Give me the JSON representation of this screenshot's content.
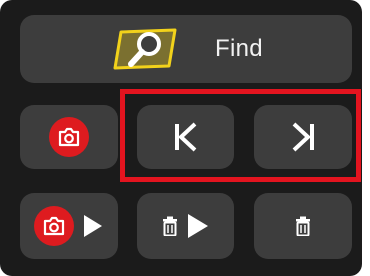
{
  "find_button": {
    "label": "Find",
    "icon": "find-magnifier-icon"
  },
  "buttons": {
    "screenshot": {
      "icon": "camera-icon"
    },
    "previous": {
      "icon": "skip-to-start-icon"
    },
    "next": {
      "icon": "skip-to-end-icon"
    },
    "screenshot_play": {
      "icons": [
        "camera-icon",
        "play-icon"
      ]
    },
    "delete_play": {
      "icons": [
        "trash-icon",
        "play-icon"
      ]
    },
    "delete": {
      "icon": "trash-icon"
    }
  },
  "highlight": {
    "target": "previous-next-button-group"
  },
  "colors": {
    "panel": "#1b1b1b",
    "button": "#3d3d3d",
    "accent_red": "#de1b1f",
    "highlight_red": "#e3141f",
    "find_icon_yellow": "#f2d21b"
  }
}
